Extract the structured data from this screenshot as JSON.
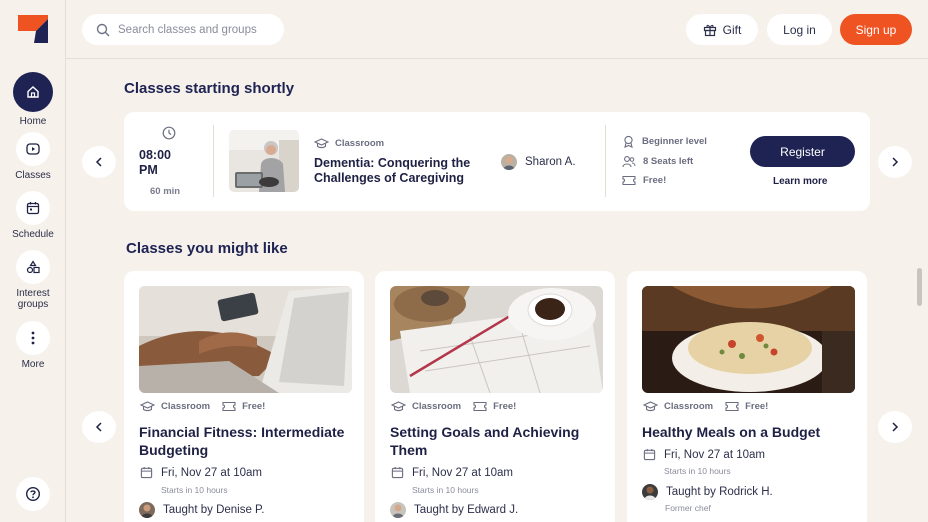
{
  "app": {
    "brand_color": "#f05322",
    "navy": "#1e2353"
  },
  "sidebar": {
    "items": [
      {
        "label": "Home",
        "icon": "home-icon",
        "active": true
      },
      {
        "label": "Classes",
        "icon": "play-icon"
      },
      {
        "label": "Schedule",
        "icon": "calendar-icon"
      },
      {
        "label": "Interest groups",
        "icon": "shapes-icon"
      },
      {
        "label": "More",
        "icon": "more-icon"
      }
    ],
    "help_icon": "help-icon"
  },
  "header": {
    "search_placeholder": "Search classes and groups",
    "gift_label": "Gift",
    "login_label": "Log in",
    "signup_label": "Sign up"
  },
  "upcoming": {
    "section_title": "Classes starting shortly",
    "time_line1": "08:00",
    "time_line2": "PM",
    "duration": "60 min",
    "type": "Classroom",
    "title": "Dementia: Conquering the Challenges of Caregiving",
    "teacher": "Sharon A.",
    "level": "Beginner level",
    "seats": "8 Seats left",
    "price": "Free!",
    "register_label": "Register",
    "learn_more_label": "Learn more"
  },
  "recommended": {
    "section_title": "Classes you might like",
    "cards": [
      {
        "type": "Classroom",
        "price": "Free!",
        "title": "Financial Fitness: Intermediate Budgeting",
        "date": "Fri, Nov 27 at 10am",
        "starts": "Starts in 10 hours",
        "teacher": "Taught by Denise P.",
        "teacher_sub": ""
      },
      {
        "type": "Classroom",
        "price": "Free!",
        "title": "Setting Goals and Achieving Them",
        "date": "Fri, Nov 27 at 10am",
        "starts": "Starts in 10 hours",
        "teacher": "Taught by Edward J.",
        "teacher_sub": ""
      },
      {
        "type": "Classroom",
        "price": "Free!",
        "title": "Healthy Meals on a Budget",
        "date": "Fri, Nov 27 at 10am",
        "starts": "Starts in 10 hours",
        "teacher": "Taught by Rodrick H.",
        "teacher_sub": "Former chef"
      }
    ]
  }
}
